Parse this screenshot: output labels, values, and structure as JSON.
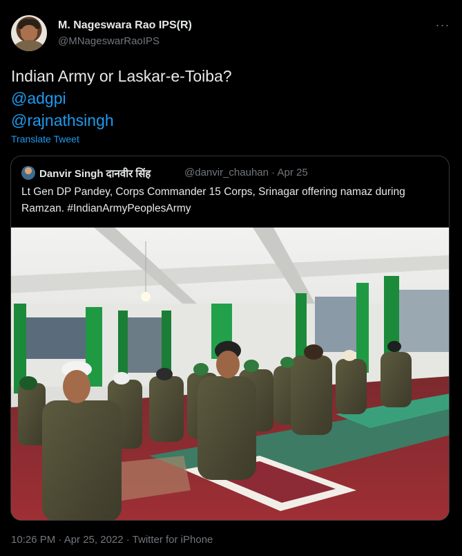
{
  "author": {
    "name": "M. Nageswara Rao IPS(R)",
    "handle": "@MNageswarRaoIPS",
    "more_icon": "more-horizontal-icon"
  },
  "tweet": {
    "line1": "Indian Army or Laskar-e-Toiba?",
    "mention1": "@adgpi",
    "mention2": "@rajnathsingh",
    "translate": "Translate Tweet"
  },
  "quoted": {
    "name": "Danvir Singh दानवीर सिंह",
    "handle_date": "@danvir_chauhan · Apr 25",
    "text": "Lt Gen DP Pandey, Corps Commander 15 Corps, Srinagar offering namaz during Ramzan. #IndianArmyPeoplesArmy"
  },
  "footer": {
    "meta": "10:26 PM · Apr 25, 2022 · Twitter for iPhone"
  },
  "colors": {
    "background": "#000000",
    "text": "#e7e9ea",
    "muted": "#71767b",
    "link": "#1d9bf0",
    "border": "#333639"
  }
}
